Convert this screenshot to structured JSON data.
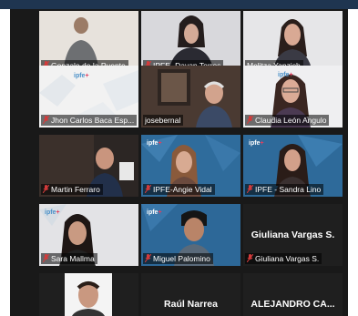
{
  "participants": [
    {
      "name": "Gonzalo de la Puente",
      "muted": true
    },
    {
      "name": "IPFE -Dayan Torres",
      "muted": true
    },
    {
      "name": "Melitza Yanzich",
      "muted": false
    },
    {
      "name": "Jhon Carlos Baca Esp...",
      "muted": true
    },
    {
      "name": "josebernal",
      "muted": false
    },
    {
      "name": "Claudia León Angulo",
      "muted": true
    },
    {
      "name": "Martin Ferraro",
      "muted": true
    },
    {
      "name": "IPFE-Angie Vidal",
      "muted": true
    },
    {
      "name": "IPFE - Sandra Lino",
      "muted": true
    },
    {
      "name": "Sara Mallma",
      "muted": true
    },
    {
      "name": "Miguel Palomino",
      "muted": true
    },
    {
      "name": "Giuliana Vargas S.",
      "muted": true,
      "big_label": "Giuliana Vargas S."
    },
    {
      "name": "",
      "muted": false
    },
    {
      "name": "",
      "muted": false,
      "big_label": "Raúl Narrea"
    },
    {
      "name": "",
      "muted": false,
      "big_label": "ALEJANDRO CA..."
    }
  ],
  "logo_text": {
    "prefix": "ipfe",
    "suffix": "+"
  },
  "colors": {
    "active_border": "#b8e000",
    "brand_blue": "#4a90c8",
    "mute_red": "#d43b3b"
  }
}
